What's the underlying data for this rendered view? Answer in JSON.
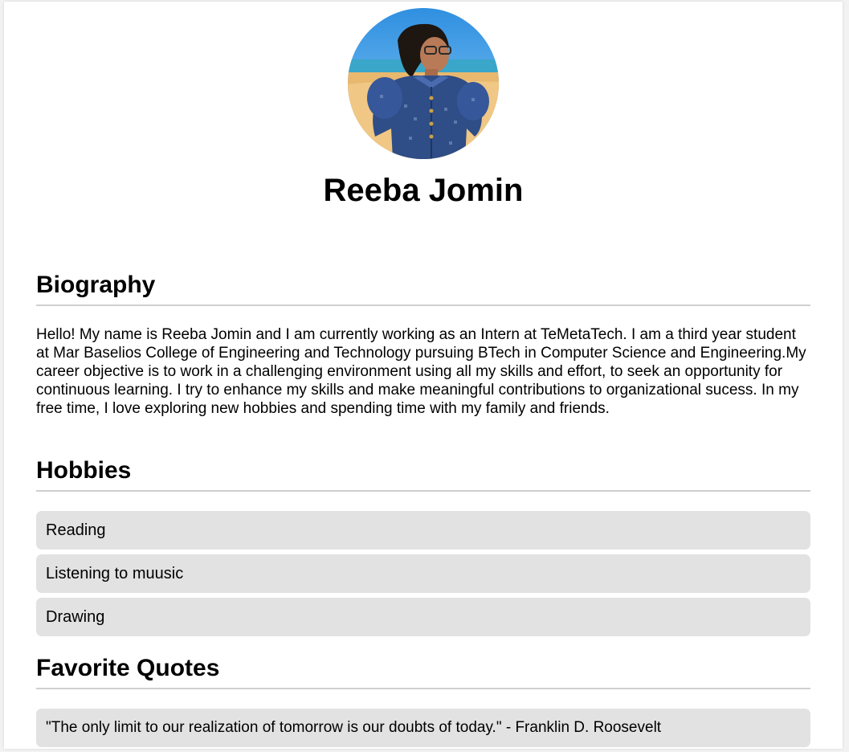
{
  "profile": {
    "name": "Reeba Jomin"
  },
  "biography": {
    "title": "Biography",
    "text": "Hello! My name is Reeba Jomin and I am currently working as an Intern at TeMetaTech. I am a third year student at Mar Baselios College of Engineering and Technology pursuing BTech in Computer Science and Engineering.My career objective is to work in a challenging environment using all my skills and effort, to seek an opportunity for continuous learning. I try to enhance my skills and make meaningful contributions to organizational sucess. In my free time, I love exploring new hobbies and spending time with my family and friends."
  },
  "hobbies": {
    "title": "Hobbies",
    "items": [
      "Reading",
      "Listening to muusic",
      "Drawing"
    ]
  },
  "quotes": {
    "title": "Favorite Quotes",
    "items": [
      "\"The only limit to our realization of tomorrow is our doubts of today.\" - Franklin D. Roosevelt"
    ]
  },
  "colors": {
    "page_background": "#ffffff",
    "list_item_background": "#e2e2e2",
    "divider": "#cfcfcf",
    "text": "#000000"
  },
  "icons": {
    "avatar": "profile-photo"
  }
}
